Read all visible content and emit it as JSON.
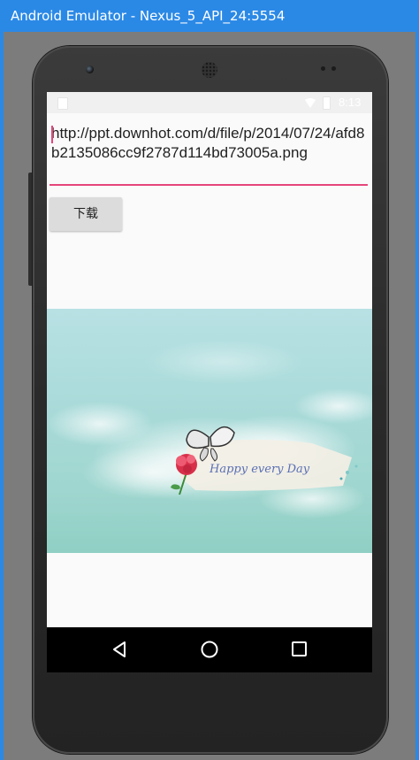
{
  "window": {
    "title": "Android Emulator - Nexus_5_API_24:5554"
  },
  "statusbar": {
    "time": "8:13"
  },
  "url_field": {
    "value": "http://ppt.downhot.com/d/file/p/2014/07/24/afd8b2135086cc9f2787d114bd73005a.png"
  },
  "download_button": {
    "label": "下载"
  },
  "image": {
    "banner_text": "Happy every Day"
  },
  "navbar": {
    "back_icon": "back-triangle-icon",
    "home_icon": "home-circle-icon",
    "recents_icon": "recents-square-icon"
  },
  "colors": {
    "titlebar": "#2b89e6",
    "accent": "#e5467a",
    "button": "#dcdcdc",
    "navbar": "#000000"
  }
}
